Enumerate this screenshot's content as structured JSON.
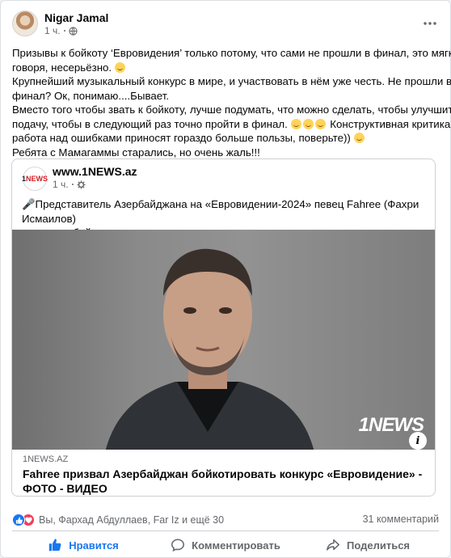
{
  "post": {
    "author": "Nigar Jamal",
    "time": "1 ч.",
    "text_lines": [
      "Призывы к бойкоту ‘Евровидения’ только потому, что сами не прошли в финал, это мягко",
      "говоря, несерьёзно.",
      "Крупнейший музыкальный конкурс в мире, и участвовать в нём уже честь. Не прошли в",
      "финал? Ок, понимаю....Бывает.",
      "Вместо того чтобы звать к бойкоту, лучше подумать, что можно сделать, чтобы улучшить",
      "подачу, чтобы в следующий раз точно пройти в финал.",
      "Конструктивная критика и",
      "работа над ошибками приносят гораздо больше пользы, поверьте))",
      " Ребята с Мамагаммы старались, но очень жаль!!!"
    ]
  },
  "shared": {
    "logo_text_1": "1",
    "logo_text_2": "NEWS",
    "source": "www.1NEWS.az",
    "time": "1 ч.",
    "text_line1": "🎤Представитель Азербайджана на «Евровидении-2024» певец Fahree (Фахри Исмаилов)",
    "text_line2": "призвал к бойкоту международного конкурса в следующие годы.",
    "watermark": "1NEWS",
    "info": "i",
    "link_domain": "1NEWS.AZ",
    "link_title": "Fahree призвал Азербайджан бойкотировать конкурс «Евровидение» - ФОТО - ВИДЕО"
  },
  "footer": {
    "reactors": "Вы, Фархад Абдуллаев, Far Iz и ещё 30",
    "comments": "31 комментарий",
    "like_label": "Нравится",
    "comment_label": "Комментировать",
    "share_label": "Поделиться"
  },
  "colors": {
    "accent": "#1877f2",
    "love": "#f33e58",
    "secondary_text": "#65676b"
  }
}
